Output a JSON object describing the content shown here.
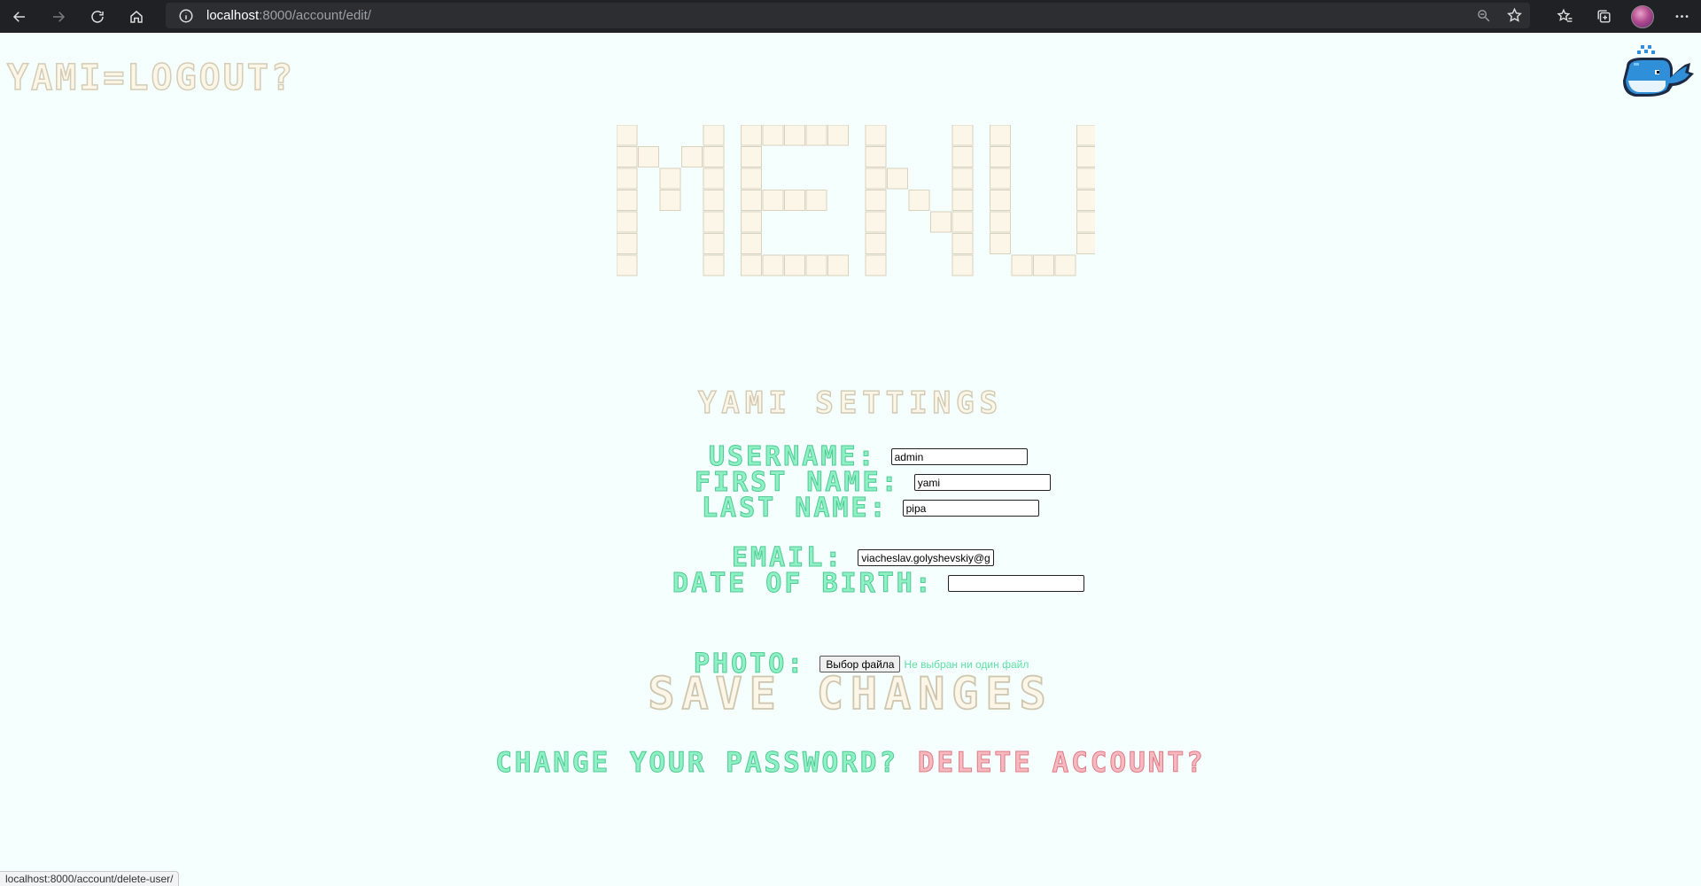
{
  "browser": {
    "url_host": "localhost",
    "url_path": ":8000/account/edit/",
    "status_url": "localhost:8000/account/delete-user/"
  },
  "header": {
    "logo_text": "YAMI=LOGOUT?",
    "mascot_icon": "whale-icon"
  },
  "menu": {
    "title_letters": "MENU"
  },
  "settings": {
    "title": "YAMI SETTINGS",
    "fields": {
      "username": {
        "label": "USERNAME:",
        "value": "admin"
      },
      "first_name": {
        "label": "FIRST NAME:",
        "value": "yami"
      },
      "last_name": {
        "label": "LAST NAME:",
        "value": "pipa"
      },
      "email": {
        "label": "EMAIL:",
        "value": "viacheslav.golyshevskiy@g"
      },
      "date_of_birth": {
        "label": "DATE OF BIRTH:",
        "value": ""
      },
      "photo": {
        "label": "PHOTO:",
        "button_label": "Выбор файла",
        "status": "Не выбран ни один файл"
      }
    },
    "save_label": "SAVE CHANGES",
    "change_password_label": "CHANGE YOUR PASSWORD?",
    "delete_account_label": "DELETE ACCOUNT?"
  },
  "colors": {
    "page_bg": "#f4fffe",
    "label_green": "#8ff0c4",
    "delete_red": "#f6b9bf",
    "cream_block": "#fbf6e8"
  }
}
